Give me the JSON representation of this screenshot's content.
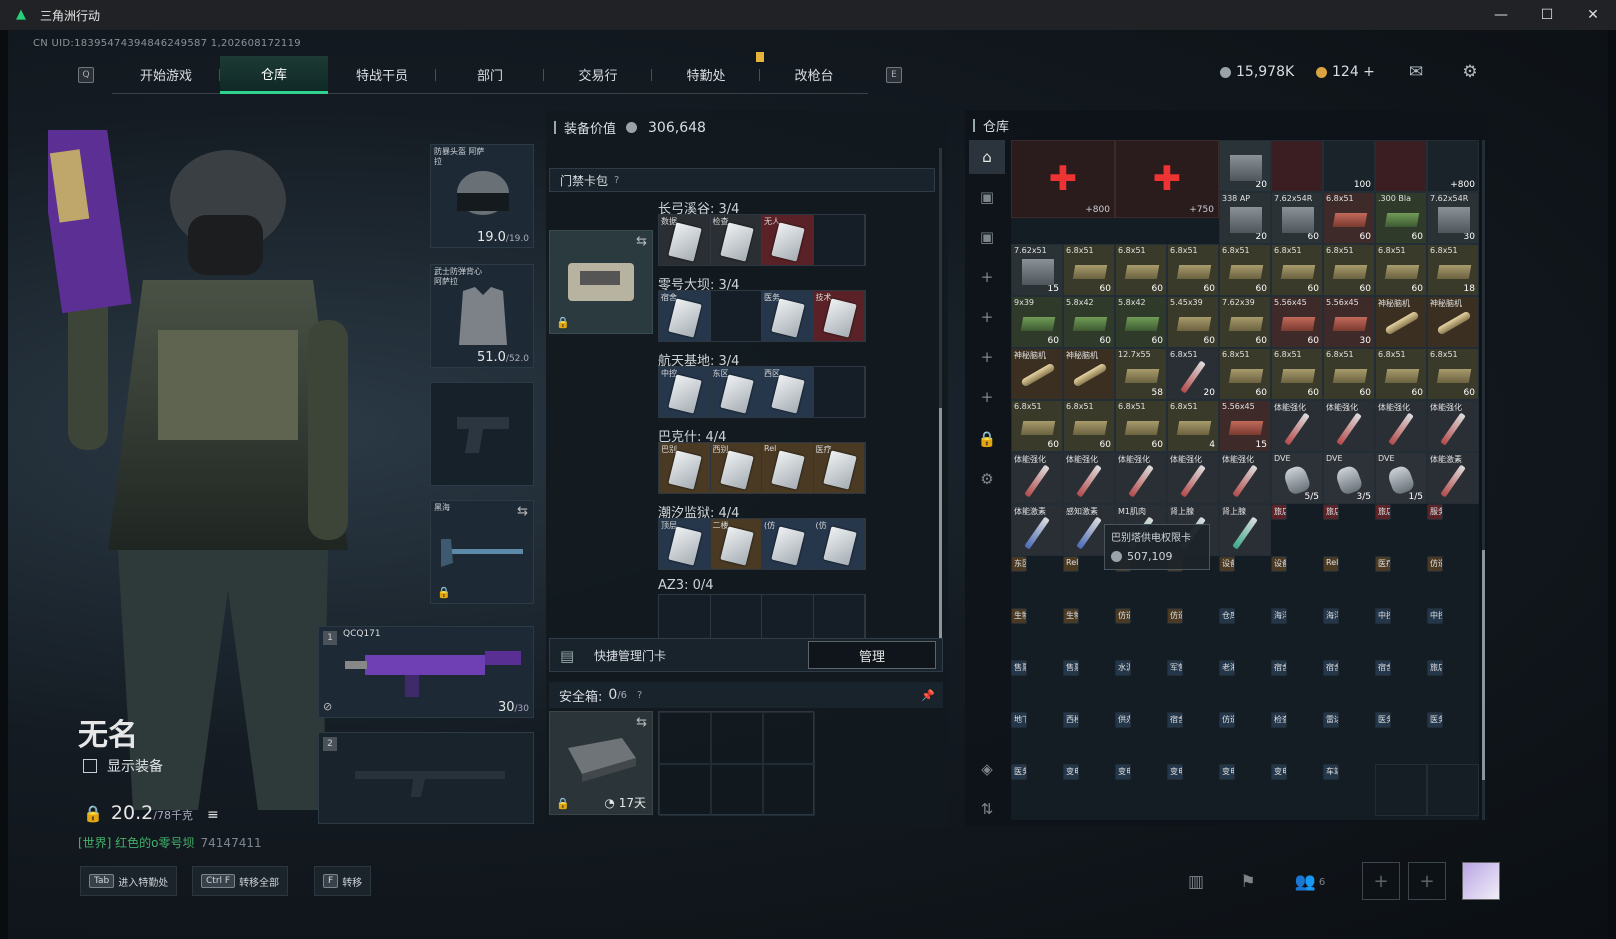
{
  "window": {
    "title": "三角洲行动",
    "controls": [
      "—",
      "☐",
      "✕"
    ]
  },
  "uid": "CN UID:18395474394846249587 1,202608172119",
  "nav": {
    "left_key": "Q",
    "right_key": "E",
    "tabs": [
      "开始游戏",
      "仓库",
      "特战干员",
      "部门",
      "交易行",
      "特勤处",
      "改枪台"
    ],
    "active": "仓库"
  },
  "currency": {
    "silver": "15,978K",
    "gold": "124 +"
  },
  "character": {
    "name": "无名",
    "show_gear": "显示装备",
    "weight": "20.2",
    "weight_max": "/78千克",
    "chat_prefix": "[世界] 红色的ο零号坝",
    "chat_uid": "74147411"
  },
  "slots": {
    "helmet": {
      "label": "防暴头盔 阿萨拉",
      "value": "19.0",
      "max": "/19.0"
    },
    "armor": {
      "label": "武士防弹背心 阿萨拉",
      "value": "51.0",
      "max": "/52.0"
    },
    "melee": {
      "label": "黑海"
    },
    "primary": {
      "index": "1",
      "name": "QCQ171",
      "ammo": "30",
      "ammo_max": "/30"
    },
    "secondary": {
      "index": "2"
    }
  },
  "mid": {
    "gear_value_label": "装备价值",
    "gear_value": "306,648",
    "card_bag_label": "门禁卡包",
    "maps": [
      {
        "title": "长弓溪谷: 3/4",
        "cells": [
          {
            "t": "数据",
            "c": "gray"
          },
          {
            "t": "检查",
            "c": "gray"
          },
          {
            "t": "无人",
            "c": "red"
          },
          {
            "t": "",
            "c": "empty"
          }
        ]
      },
      {
        "title": "零号大坝: 3/4",
        "cells": [
          {
            "t": "宿舍",
            "c": "blue"
          },
          {
            "t": "",
            "c": "empty"
          },
          {
            "t": "医务",
            "c": "blue"
          },
          {
            "t": "技术",
            "c": "red"
          }
        ]
      },
      {
        "title": "航天基地: 3/4",
        "cells": [
          {
            "t": "中控",
            "c": "blue"
          },
          {
            "t": "东区",
            "c": "blue"
          },
          {
            "t": "西区",
            "c": "blue"
          },
          {
            "t": "",
            "c": "empty"
          }
        ]
      },
      {
        "title": "巴克什: 4/4",
        "cells": [
          {
            "t": "巴别",
            "c": "gold"
          },
          {
            "t": "西别",
            "c": "gold"
          },
          {
            "t": "Rel",
            "c": "gold"
          },
          {
            "t": "医疗",
            "c": "gold"
          }
        ]
      },
      {
        "title": "潮汐监狱: 4/4",
        "cells": [
          {
            "t": "顶层",
            "c": "blue"
          },
          {
            "t": "二楼",
            "c": "gold"
          },
          {
            "t": "(仿",
            "c": "blue"
          },
          {
            "t": "(仿",
            "c": "blue"
          }
        ]
      },
      {
        "title": "AZ3: 0/4",
        "cells": []
      }
    ],
    "quick_label": "快捷管理门卡",
    "manage_btn": "管理",
    "safe_label": "安全箱:",
    "safe_value": "0",
    "safe_max": "/6",
    "safe_time": "17天"
  },
  "stash": {
    "title": "仓库",
    "tooltip": {
      "name": "巴别塔供电权限卡",
      "value": "507,109"
    },
    "row0": [
      {
        "q": "+800"
      },
      {
        "q": "+750"
      },
      {
        "nm": "338 AP",
        "q": "20"
      },
      {
        "nm": "7.62x54R",
        "q": "60"
      },
      {
        "nm": "6.8x51",
        "q": "60"
      },
      {
        "nm": ".300 Bla",
        "q": "60"
      },
      {
        "nm": "7.62x54R",
        "q": "30"
      }
    ],
    "row0top": [
      {
        "q": "20"
      },
      {
        "q": "100"
      },
      {
        "q": "+800"
      }
    ],
    "rows": [
      [
        {
          "c": "box",
          "nm": "7.62x51",
          "q": "15"
        },
        {
          "c": "ammo",
          "nm": "6.8x51",
          "q": "60"
        },
        {
          "c": "ammo",
          "nm": "6.8x51",
          "q": "60"
        },
        {
          "c": "ammo",
          "nm": "6.8x51",
          "q": "60"
        },
        {
          "c": "ammo",
          "nm": "6.8x51",
          "q": "60"
        },
        {
          "c": "ammo",
          "nm": "6.8x51",
          "q": "60"
        },
        {
          "c": "ammo",
          "nm": "6.8x51",
          "q": "60"
        },
        {
          "c": "ammo",
          "nm": "6.8x51",
          "q": "60"
        },
        {
          "c": "ammo",
          "nm": "6.8x51",
          "q": "18"
        }
      ],
      [
        {
          "c": "ammo-g",
          "nm": "9x39",
          "q": "60"
        },
        {
          "c": "ammo-g",
          "nm": "5.8x42",
          "q": "60"
        },
        {
          "c": "ammo-g",
          "nm": "5.8x42",
          "q": "60"
        },
        {
          "c": "ammo",
          "nm": "5.45x39",
          "q": "60"
        },
        {
          "c": "ammo",
          "nm": "7.62x39",
          "q": "60"
        },
        {
          "c": "ammo-r",
          "nm": "5.56x45",
          "q": "60"
        },
        {
          "c": "ammo-r",
          "nm": "5.56x45",
          "q": "30"
        },
        {
          "c": "pipe",
          "nm": "神秘脑机",
          "q": ""
        },
        {
          "c": "pipe",
          "nm": "神秘脑机",
          "q": ""
        }
      ],
      [
        {
          "c": "pipe",
          "nm": "神秘脑机",
          "q": ""
        },
        {
          "c": "pipe",
          "nm": "神秘脑机",
          "q": ""
        },
        {
          "c": "ammo",
          "nm": "12.7x55",
          "q": "58"
        },
        {
          "c": "syr",
          "nm": "6.8x51",
          "q": "20"
        },
        {
          "c": "ammo",
          "nm": "6.8x51",
          "q": "60"
        },
        {
          "c": "ammo",
          "nm": "6.8x51",
          "q": "60"
        },
        {
          "c": "ammo",
          "nm": "6.8x51",
          "q": "60"
        },
        {
          "c": "ammo",
          "nm": "6.8x51",
          "q": "60"
        },
        {
          "c": "ammo",
          "nm": "6.8x51",
          "q": "60"
        }
      ],
      [
        {
          "c": "ammo",
          "nm": "6.8x51",
          "q": "60"
        },
        {
          "c": "ammo",
          "nm": "6.8x51",
          "q": "60"
        },
        {
          "c": "ammo",
          "nm": "6.8x51",
          "q": "60"
        },
        {
          "c": "ammo",
          "nm": "6.8x51",
          "q": "4"
        },
        {
          "c": "ammo-r",
          "nm": "5.56x45",
          "q": "15"
        },
        {
          "c": "syr",
          "nm": "体能强化",
          "q": ""
        },
        {
          "c": "syr",
          "nm": "体能强化",
          "q": ""
        },
        {
          "c": "syr",
          "nm": "体能强化",
          "q": ""
        },
        {
          "c": "syr",
          "nm": "体能强化",
          "q": ""
        }
      ],
      [
        {
          "c": "syr",
          "nm": "体能强化",
          "q": ""
        },
        {
          "c": "syr",
          "nm": "体能强化",
          "q": ""
        },
        {
          "c": "syr",
          "nm": "体能强化",
          "q": ""
        },
        {
          "c": "syr",
          "nm": "体能强化",
          "q": ""
        },
        {
          "c": "syr",
          "nm": "体能强化",
          "q": ""
        },
        {
          "c": "inj",
          "nm": "DVE",
          "q": "5/5"
        },
        {
          "c": "inj",
          "nm": "DVE",
          "q": "3/5"
        },
        {
          "c": "inj",
          "nm": "DVE",
          "q": "1/5"
        },
        {
          "c": "syr",
          "nm": "体能激素",
          "q": ""
        }
      ],
      [
        {
          "c": "syr syr-b",
          "nm": "体能激素",
          "q": ""
        },
        {
          "c": "syr syr-b",
          "nm": "感知激素",
          "q": ""
        },
        {
          "c": "syr syr-g",
          "nm": "M1肌肉",
          "q": ""
        },
        {
          "c": "syr syr-g",
          "nm": "肾上腺",
          "q": ""
        },
        {
          "c": "syr syr-g",
          "nm": "肾上腺",
          "q": ""
        },
        {
          "c": "key red",
          "nm": "旅店",
          "q": ""
        },
        {
          "c": "key red",
          "nm": "旅店",
          "q": ""
        },
        {
          "c": "key red",
          "nm": "旅店",
          "q": ""
        },
        {
          "c": "key red",
          "nm": "服务",
          "q": ""
        }
      ],
      [
        {
          "c": "key gold",
          "nm": "东区",
          "q": ""
        },
        {
          "c": "key gold",
          "nm": "Rel",
          "q": ""
        },
        {
          "c": "key gold",
          "nm": "",
          "q": ""
        },
        {
          "c": "key gold",
          "nm": "",
          "q": ""
        },
        {
          "c": "key gold",
          "nm": "设备",
          "q": ""
        },
        {
          "c": "key gold",
          "nm": "设备",
          "q": ""
        },
        {
          "c": "key gold",
          "nm": "Rel",
          "q": ""
        },
        {
          "c": "key gold",
          "nm": "医疗",
          "q": ""
        },
        {
          "c": "key gold",
          "nm": "仿造",
          "q": ""
        }
      ],
      [
        {
          "c": "key gold",
          "nm": "生物",
          "q": ""
        },
        {
          "c": "key gold",
          "nm": "生物",
          "q": ""
        },
        {
          "c": "key gold",
          "nm": "仿造",
          "q": ""
        },
        {
          "c": "key gold",
          "nm": "仿造",
          "q": ""
        },
        {
          "c": "key blue",
          "nm": "仓库",
          "q": ""
        },
        {
          "c": "key blue",
          "nm": "海洋",
          "q": ""
        },
        {
          "c": "key blue",
          "nm": "海洋",
          "q": ""
        },
        {
          "c": "key blue",
          "nm": "中控",
          "q": ""
        },
        {
          "c": "key blue",
          "nm": "中控",
          "q": ""
        }
      ],
      [
        {
          "c": "key blue",
          "nm": "售票",
          "q": ""
        },
        {
          "c": "key blue",
          "nm": "售票",
          "q": ""
        },
        {
          "c": "key blue",
          "nm": "水泥",
          "q": ""
        },
        {
          "c": "key blue",
          "nm": "军营",
          "q": ""
        },
        {
          "c": "key blue",
          "nm": "老港",
          "q": ""
        },
        {
          "c": "key blue",
          "nm": "宿舍",
          "q": ""
        },
        {
          "c": "key blue",
          "nm": "宿舍",
          "q": ""
        },
        {
          "c": "key blue",
          "nm": "宿舍",
          "q": ""
        },
        {
          "c": "key blue",
          "nm": "旅店",
          "q": ""
        }
      ],
      [
        {
          "c": "key blue",
          "nm": "地下",
          "q": ""
        },
        {
          "c": "key blue",
          "nm": "西楼",
          "q": ""
        },
        {
          "c": "key blue",
          "nm": "供办",
          "q": ""
        },
        {
          "c": "key blue",
          "nm": "宿舍",
          "q": ""
        },
        {
          "c": "key blue",
          "nm": "仿造",
          "q": ""
        },
        {
          "c": "key blue",
          "nm": "检查",
          "q": ""
        },
        {
          "c": "key blue",
          "nm": "雷达",
          "q": ""
        },
        {
          "c": "key blue",
          "nm": "医务",
          "q": ""
        },
        {
          "c": "key blue",
          "nm": "医务",
          "q": ""
        }
      ],
      [
        {
          "c": "key blue",
          "nm": "医务",
          "q": ""
        },
        {
          "c": "key blue",
          "nm": "变电",
          "q": ""
        },
        {
          "c": "key blue",
          "nm": "变电",
          "q": ""
        },
        {
          "c": "key blue",
          "nm": "变电",
          "q": ""
        },
        {
          "c": "key blue",
          "nm": "变电",
          "q": ""
        },
        {
          "c": "key blue",
          "nm": "变电",
          "q": ""
        },
        {
          "c": "key blue",
          "nm": "车站",
          "q": ""
        },
        {
          "c": "empty",
          "nm": "",
          "q": ""
        },
        {
          "c": "empty",
          "nm": "",
          "q": ""
        }
      ]
    ]
  },
  "hints": [
    {
      "k": "Tab",
      "t": "进入特勤处"
    },
    {
      "k": "Ctrl F",
      "t": "转移全部"
    },
    {
      "k": "F",
      "t": "转移"
    }
  ],
  "social": {
    "friends": "6"
  }
}
